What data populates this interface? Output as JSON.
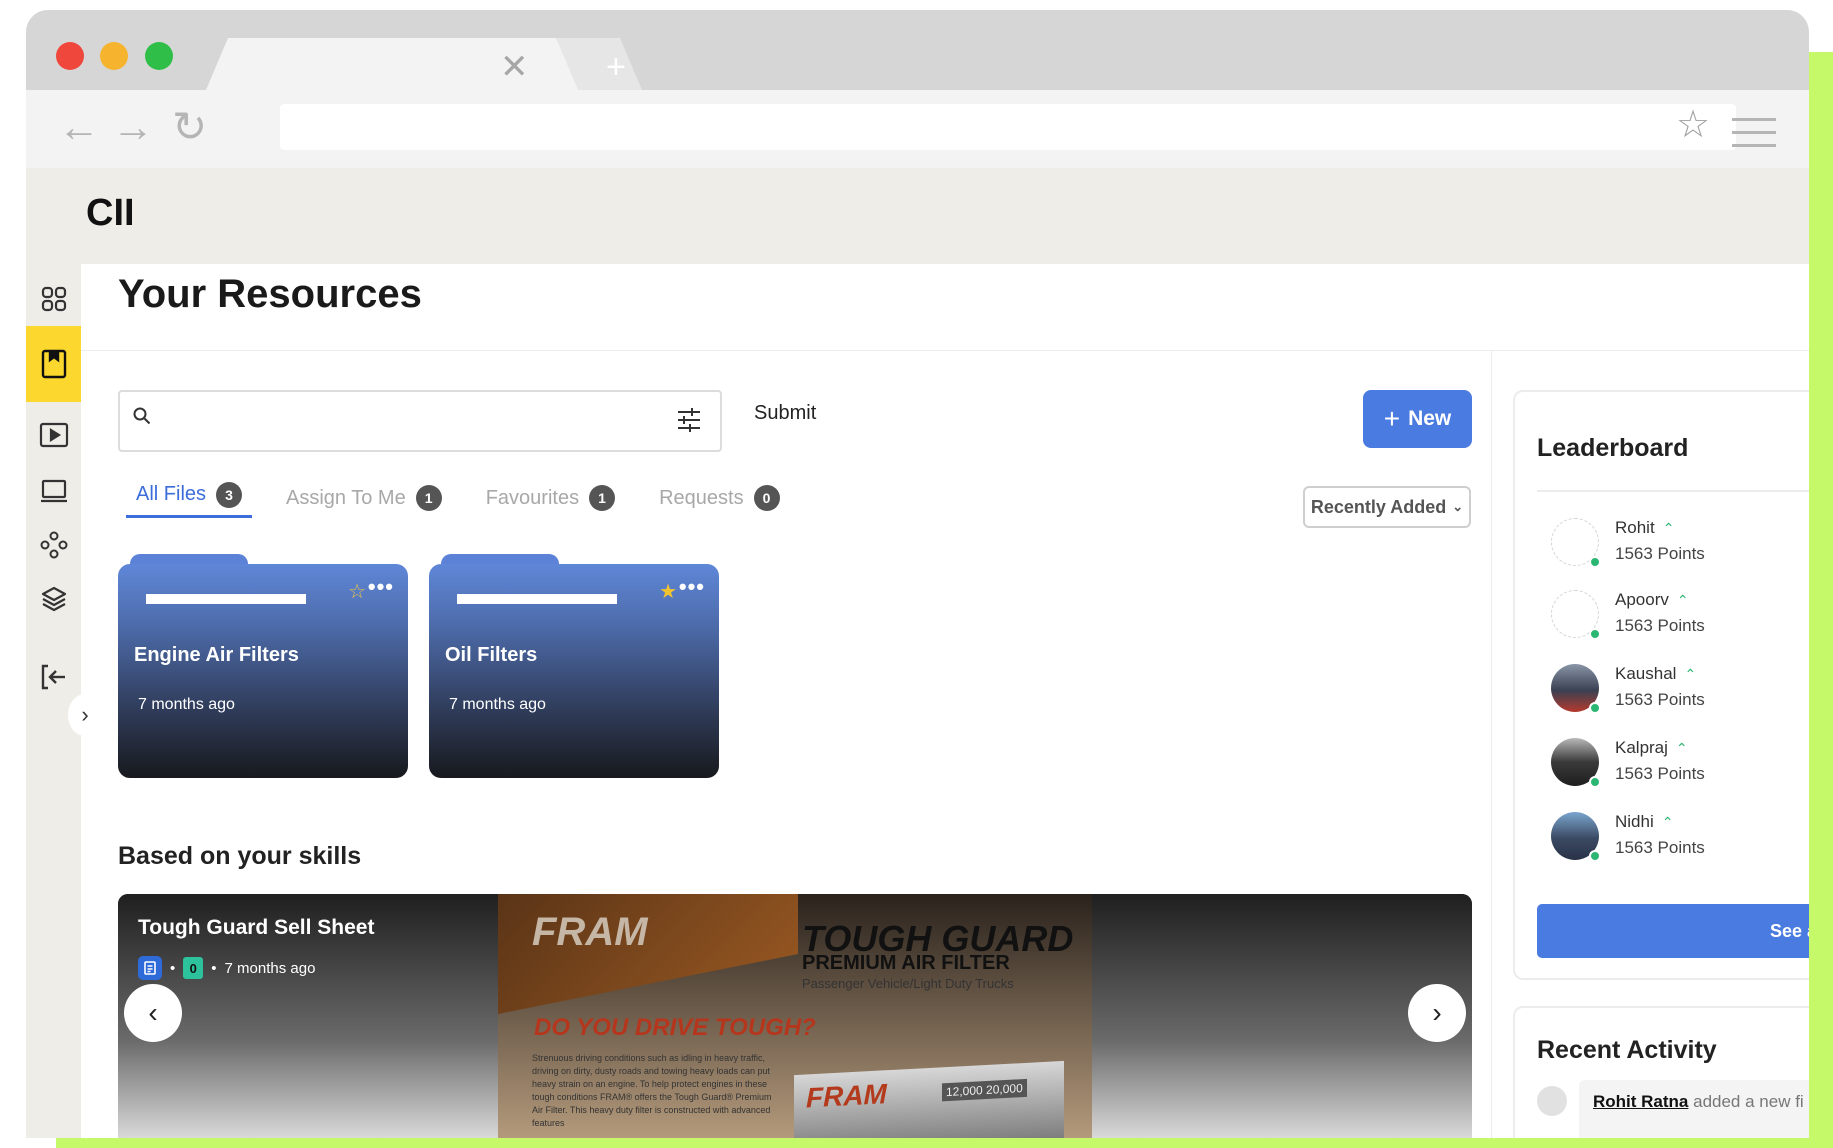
{
  "app": {
    "name": "CII"
  },
  "page": {
    "title": "Your Resources"
  },
  "search": {
    "placeholder": "",
    "value": ""
  },
  "actions": {
    "submit": "Submit",
    "new": "New"
  },
  "tabs": [
    {
      "label": "All Files",
      "count": "3",
      "active": true
    },
    {
      "label": "Assign To Me",
      "count": "1",
      "active": false
    },
    {
      "label": "Favourites",
      "count": "1",
      "active": false
    },
    {
      "label": "Requests",
      "count": "0",
      "active": false
    }
  ],
  "sort": {
    "selected": "Recently Added"
  },
  "folders": [
    {
      "name": "Engine Air Filters",
      "date": "7 months ago",
      "favourite": false
    },
    {
      "name": "Oil Filters",
      "date": "7 months ago",
      "favourite": true
    }
  ],
  "skills": {
    "title": "Based on your skills",
    "item": {
      "title": "Tough Guard Sell Sheet",
      "count": "0",
      "date": "7 months ago",
      "preview": {
        "brand": "FRAM",
        "product": "TOUGH GUARD",
        "subtitle": "PREMIUM AIR FILTER",
        "small": "Passenger Vehicle/Light Duty Trucks",
        "question": "DO YOU DRIVE TOUGH?",
        "body": "Strenuous driving conditions such as idling in heavy traffic, driving on dirty, dusty roads and towing heavy loads can put heavy strain on an engine. To help protect engines in these tough conditions FRAM® offers the Tough Guard® Premium Air Filter. This heavy duty filter is constructed with advanced features",
        "box_brand": "FRAM",
        "box_numbers": "12,000 20,000"
      }
    }
  },
  "leaderboard": {
    "title": "Leaderboard",
    "users": [
      {
        "name": "Rohit",
        "points": "1563 Points"
      },
      {
        "name": "Apoorv",
        "points": "1563 Points"
      },
      {
        "name": "Kaushal",
        "points": "1563 Points"
      },
      {
        "name": "Kalpraj",
        "points": "1563 Points"
      },
      {
        "name": "Nidhi",
        "points": "1563 Points"
      }
    ],
    "see_all": "See all"
  },
  "recent_activity": {
    "title": "Recent Activity",
    "user": "Rohit Ratna",
    "text": " added a new fi"
  },
  "colors": {
    "accent": "#4a7be0",
    "active_nav": "#fcd82e",
    "frame": "#c6f96a"
  }
}
